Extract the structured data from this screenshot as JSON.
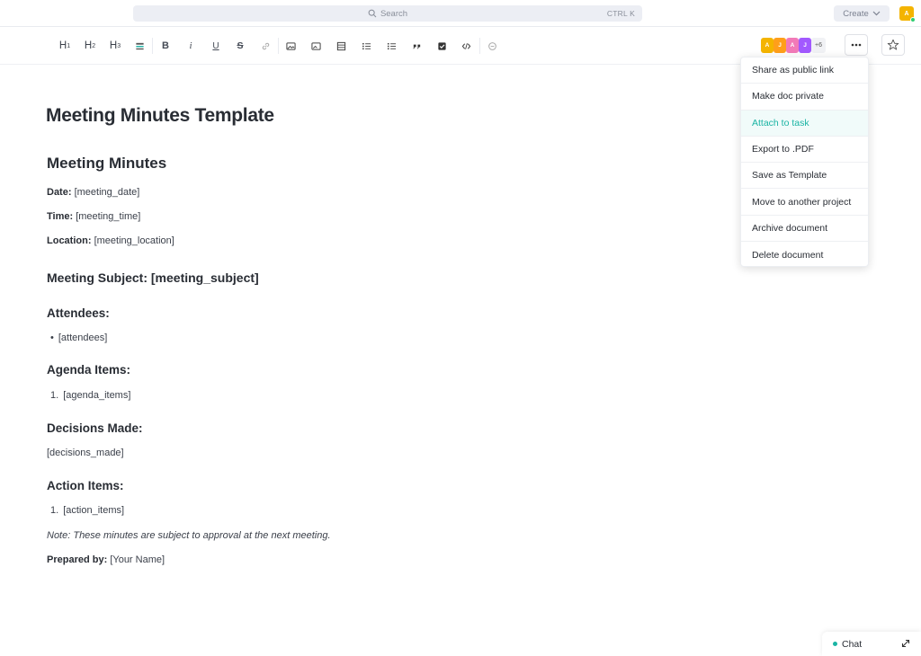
{
  "topbar": {
    "search_placeholder": "Search",
    "search_shortcut": "CTRL K",
    "create_label": "Create",
    "user_initial": "A"
  },
  "toolbar": {
    "h1": "H",
    "h1_sub": "1",
    "h2": "H",
    "h2_sub": "2",
    "h3": "H",
    "h3_sub": "3",
    "bold": "B",
    "italic": "i",
    "underline": "U",
    "strike": "S",
    "collaborators": [
      {
        "initial": "A",
        "color": "#f4b400"
      },
      {
        "initial": "J",
        "color": "#ff9f1a"
      },
      {
        "initial": "A",
        "color": "#f27ab8"
      },
      {
        "initial": "J",
        "color": "#a259ff"
      }
    ],
    "more_collaborators": "+6"
  },
  "document": {
    "title": "Meeting Minutes Template",
    "heading": "Meeting Minutes",
    "date_label": "Date:",
    "date_value": "[meeting_date]",
    "time_label": "Time:",
    "time_value": "[meeting_time]",
    "location_label": "Location:",
    "location_value": "[meeting_location]",
    "subject_heading": "Meeting Subject: [meeting_subject]",
    "attendees_heading": "Attendees:",
    "attendees_item": "[attendees]",
    "agenda_heading": "Agenda Items:",
    "agenda_num": "1.",
    "agenda_item": "[agenda_items]",
    "decisions_heading": "Decisions Made:",
    "decisions_value": "[decisions_made]",
    "action_heading": "Action Items:",
    "action_num": "1.",
    "action_item": "[action_items]",
    "note": "Note: These minutes are subject to approval at the next meeting.",
    "prepared_label": "Prepared by:",
    "prepared_value": "[Your Name]"
  },
  "menu": {
    "items": [
      {
        "label": "Share as public link"
      },
      {
        "label": "Make doc private"
      },
      {
        "label": "Attach to task"
      },
      {
        "label": "Export to .PDF"
      },
      {
        "label": "Save as Template"
      },
      {
        "label": "Move to another project"
      },
      {
        "label": "Archive document"
      },
      {
        "label": "Delete document"
      }
    ],
    "highlight_color": "#1ab4a4"
  },
  "chat": {
    "label": "Chat"
  }
}
